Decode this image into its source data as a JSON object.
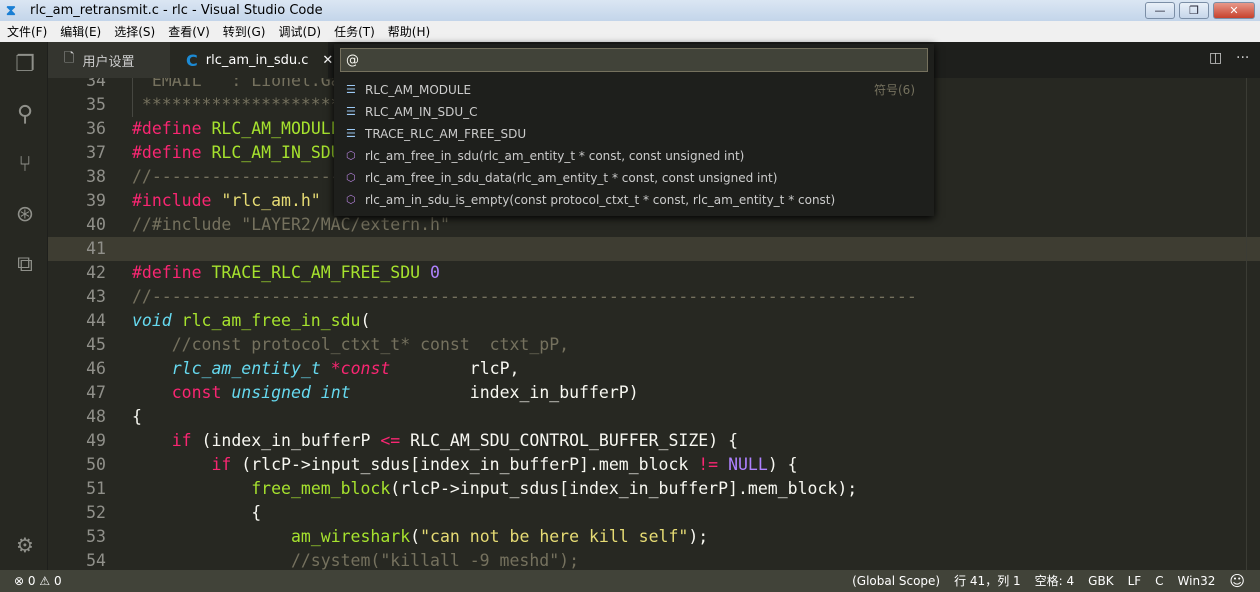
{
  "window": {
    "title": "rlc_am_retransmit.c - rlc - Visual Studio Code",
    "minimize": "—",
    "restore": "❐",
    "close": "✕"
  },
  "menu": [
    "文件(F)",
    "编辑(E)",
    "选择(S)",
    "查看(V)",
    "转到(G)",
    "调试(D)",
    "任务(T)",
    "帮助(H)"
  ],
  "tabs": [
    {
      "label": "用户设置",
      "icon": "file-icon"
    },
    {
      "label": "rlc_am_in_sdu.c",
      "icon": "c-language-icon",
      "close": "✕"
    }
  ],
  "editor_actions": {
    "split": "◫",
    "more": "···"
  },
  "quick_open": {
    "value": "@",
    "count_label": "符号(6)",
    "items": [
      {
        "kind": "constant",
        "label": "RLC_AM_MODULE"
      },
      {
        "kind": "constant",
        "label": "RLC_AM_IN_SDU_C"
      },
      {
        "kind": "constant",
        "label": "TRACE_RLC_AM_FREE_SDU"
      },
      {
        "kind": "function",
        "label": "rlc_am_free_in_sdu(rlc_am_entity_t * const, const unsigned int)"
      },
      {
        "kind": "function",
        "label": "rlc_am_free_in_sdu_data(rlc_am_entity_t * const, const unsigned int)"
      },
      {
        "kind": "function",
        "label": "rlc_am_in_sdu_is_empty(const protocol_ctxt_t * const, rlc_am_entity_t * const)"
      }
    ]
  },
  "code": [
    {
      "n": "34",
      "t": [
        [
          "c",
          "  EMAIL   : Lionel.Ga"
        ]
      ]
    },
    {
      "n": "35",
      "t": [
        [
          "c",
          " ***********************"
        ]
      ]
    },
    {
      "n": "36",
      "t": [
        [
          "k",
          "#define "
        ],
        [
          "f",
          "RLC_AM_MODULE"
        ]
      ]
    },
    {
      "n": "37",
      "t": [
        [
          "k",
          "#define "
        ],
        [
          "f",
          "RLC_AM_IN_SDU_C"
        ]
      ]
    },
    {
      "n": "38",
      "t": [
        [
          "c",
          "//----------------------"
        ]
      ]
    },
    {
      "n": "39",
      "t": [
        [
          "k",
          "#include "
        ],
        [
          "s",
          "\"rlc_am.h\""
        ]
      ]
    },
    {
      "n": "40",
      "t": [
        [
          "c",
          "//#include \"LAYER2/MAC/extern.h\""
        ]
      ]
    },
    {
      "n": "41",
      "t": []
    },
    {
      "n": "42",
      "t": [
        [
          "k",
          "#define "
        ],
        [
          "f",
          "TRACE_RLC_AM_FREE_SDU "
        ],
        [
          "n",
          "0"
        ]
      ]
    },
    {
      "n": "43",
      "t": [
        [
          "c",
          "//-----------------------------------------------------------------------------"
        ]
      ]
    },
    {
      "n": "44",
      "t": [
        [
          "t",
          "void "
        ],
        [
          "f",
          "rlc_am_free_in_sdu"
        ],
        [
          "p",
          "("
        ]
      ]
    },
    {
      "n": "45",
      "t": [
        [
          "c",
          "    //const protocol_ctxt_t* const  ctxt_pP,"
        ]
      ]
    },
    {
      "n": "46",
      "t": [
        [
          "p",
          "    "
        ],
        [
          "t",
          "rlc_am_entity_t "
        ],
        [
          "k",
          "*"
        ],
        [
          "ki",
          "const"
        ],
        [
          "p",
          "        rlcP,"
        ]
      ]
    },
    {
      "n": "47",
      "t": [
        [
          "p",
          "    "
        ],
        [
          "k",
          "const "
        ],
        [
          "t",
          "unsigned int"
        ],
        [
          "p",
          "            index_in_bufferP)"
        ]
      ]
    },
    {
      "n": "48",
      "t": [
        [
          "p",
          "{"
        ]
      ]
    },
    {
      "n": "49",
      "t": [
        [
          "p",
          "    "
        ],
        [
          "k",
          "if"
        ],
        [
          "p",
          " (index_in_bufferP "
        ],
        [
          "k",
          "<="
        ],
        [
          "p",
          " RLC_AM_SDU_CONTROL_BUFFER_SIZE) {"
        ]
      ]
    },
    {
      "n": "50",
      "t": [
        [
          "p",
          "        "
        ],
        [
          "k",
          "if"
        ],
        [
          "p",
          " (rlcP->input_sdus[index_in_bufferP].mem_block "
        ],
        [
          "k",
          "!="
        ],
        [
          "p",
          " "
        ],
        [
          "n",
          "NULL"
        ],
        [
          "p",
          ") {"
        ]
      ]
    },
    {
      "n": "51",
      "t": [
        [
          "p",
          "            "
        ],
        [
          "f",
          "free_mem_block"
        ],
        [
          "p",
          "(rlcP->input_sdus[index_in_bufferP].mem_block);"
        ]
      ]
    },
    {
      "n": "52",
      "t": [
        [
          "p",
          "            {"
        ]
      ]
    },
    {
      "n": "53",
      "t": [
        [
          "p",
          "                "
        ],
        [
          "f",
          "am_wireshark"
        ],
        [
          "p",
          "("
        ],
        [
          "s",
          "\"can not be here kill self\""
        ],
        [
          "p",
          ");"
        ]
      ]
    },
    {
      "n": "54",
      "t": [
        [
          "c",
          "                //system(\"killall -9 meshd\");"
        ]
      ]
    }
  ],
  "current_line": "41",
  "status": {
    "errors": "0",
    "warnings": "0",
    "scope": "(Global Scope)",
    "position": "行 41，列 1",
    "indent": "空格: 4",
    "encoding": "GBK",
    "eol": "LF",
    "language": "C",
    "platform": "Win32",
    "feedback": "☺"
  },
  "colors": {
    "background": "#272822",
    "keyword": "#f92672",
    "function": "#a6e22e",
    "string": "#e6db74",
    "comment": "#75715e",
    "number": "#ae81ff",
    "type": "#66d9ef",
    "statusbar": "#414339"
  }
}
